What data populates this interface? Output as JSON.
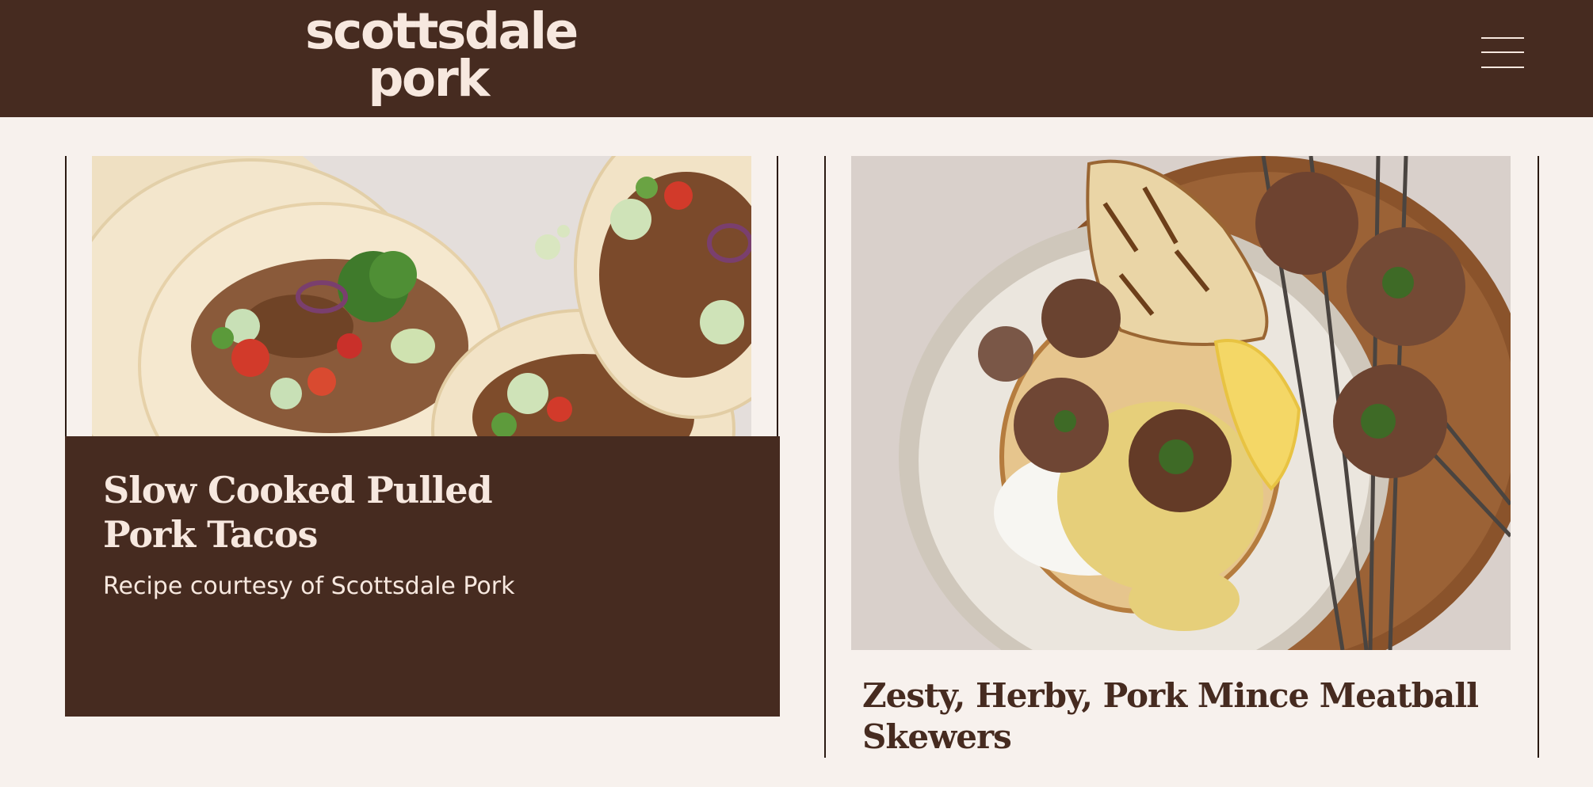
{
  "header": {
    "logo_line1": "scottsdale",
    "logo_line2": "pork",
    "menu_icon": "hamburger-menu-icon"
  },
  "cards": [
    {
      "title_line1": "Slow Cooked Pulled",
      "title_line2": "Pork Tacos",
      "subtitle": "Recipe courtesy of Scottsdale Pork",
      "image_icon": "pulled-pork-tacos-photo"
    },
    {
      "title_line1": "Zesty, Herby, Pork Mince Meatball",
      "title_line2": "Skewers",
      "image_icon": "pork-meatball-skewers-photo"
    }
  ],
  "colors": {
    "brand_brown": "#462b20",
    "cream": "#f7e8df",
    "page_bg": "#f7f1ed"
  }
}
